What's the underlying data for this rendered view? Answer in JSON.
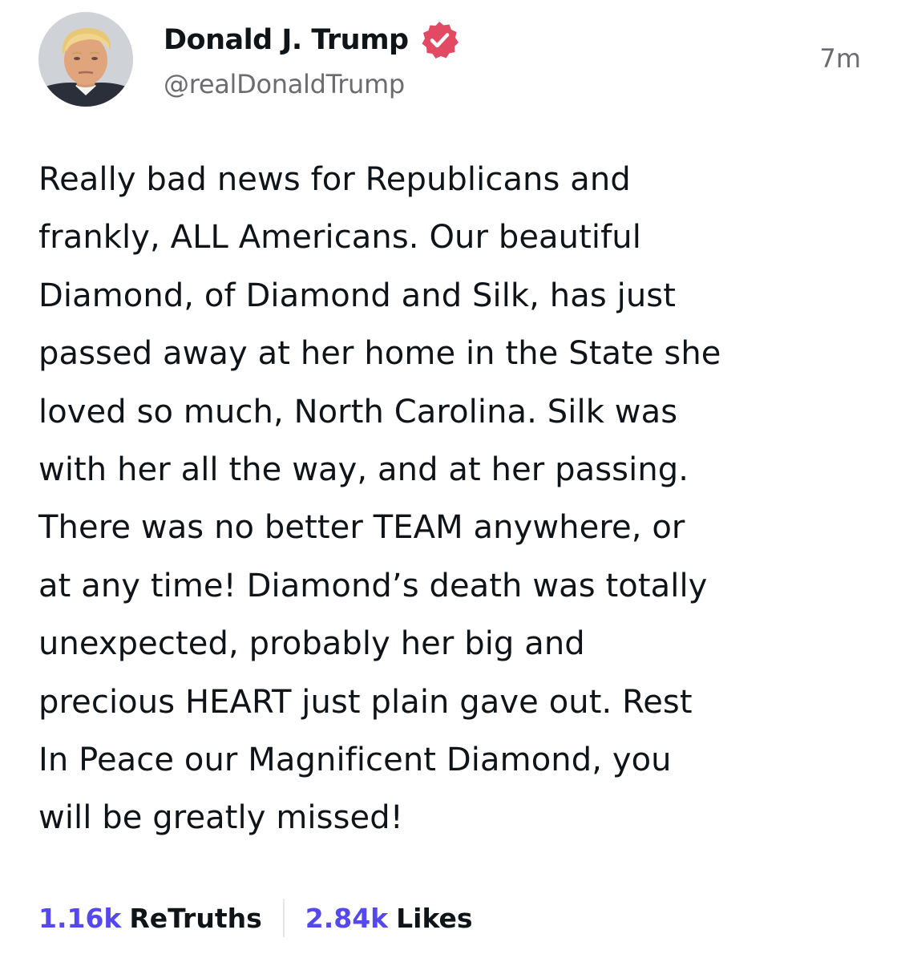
{
  "post": {
    "author": {
      "display_name": "Donald J. Trump",
      "handle": "@realDonaldTrump",
      "verified_icon": "verified-badge-icon",
      "verified_color": "#e24a64"
    },
    "timestamp": "7m",
    "body_lines": [
      "Really bad news for Republicans and",
      "frankly, ALL Americans. Our beautiful",
      "Diamond, of Diamond and Silk, has just",
      "passed away at her home in the State she",
      "loved so much, North Carolina. Silk was",
      "with her all the way, and at her passing.",
      "There was no better TEAM anywhere, or",
      "at any time! Diamond’s death was totally",
      "unexpected, probably her big and",
      "precious HEART just plain gave out. Rest",
      "In Peace our Magnificent Diamond, you",
      "will be greatly missed!"
    ],
    "stats": {
      "retruths_count": "1.16k",
      "retruths_label": "ReTruths",
      "likes_count": "2.84k",
      "likes_label": "Likes",
      "count_color": "#5448ee"
    }
  }
}
